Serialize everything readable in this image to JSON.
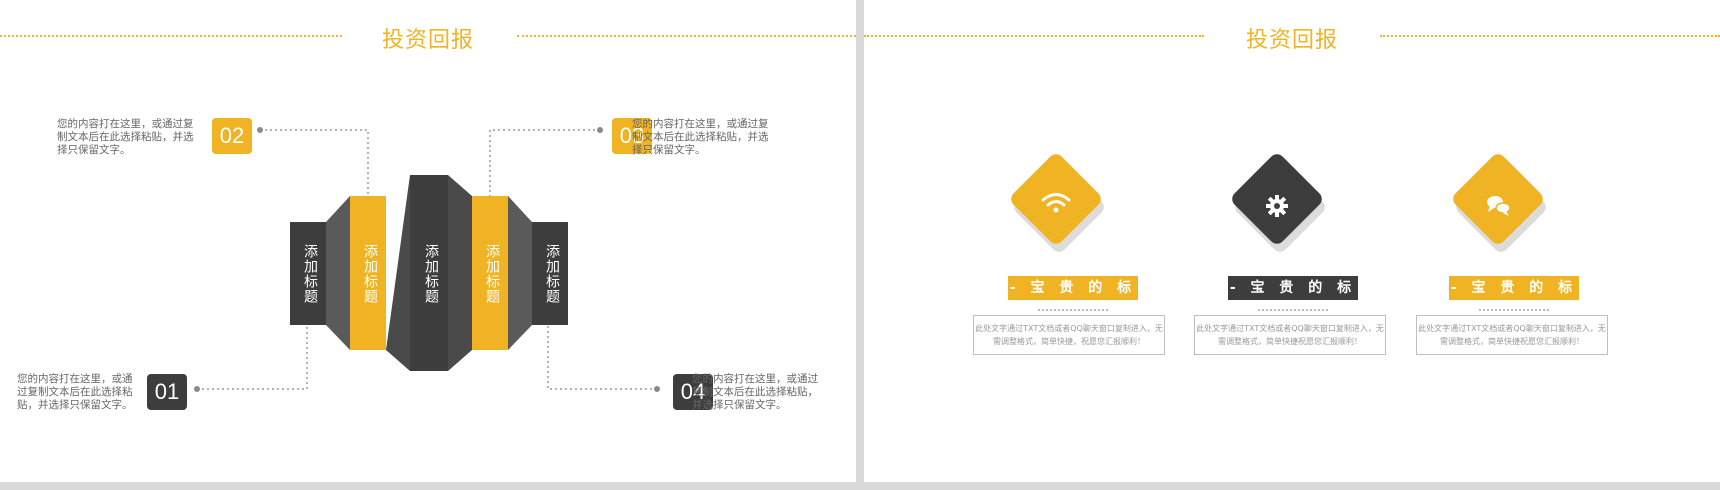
{
  "left_slide": {
    "title": "投资回报",
    "strips": [
      {
        "label": "添加标题",
        "color": "#3d3d3d"
      },
      {
        "label": "添加标题",
        "color": "#f0b323"
      },
      {
        "label": "添加标题",
        "color": "#3d3d3d"
      },
      {
        "label": "添加标题",
        "color": "#f0b323"
      },
      {
        "label": "添加标题",
        "color": "#3d3d3d"
      }
    ],
    "items": [
      {
        "number": "01",
        "text": "您的内容打在这里，或通过复制文本后在此选择粘贴，并选择只保留文字。",
        "color": "#3d3d3d"
      },
      {
        "number": "02",
        "text": "您的内容打在这里，或通过复制文本后在此选择粘贴，并选择只保留文字。",
        "color": "#f0b323"
      },
      {
        "number": "03",
        "text": "您的内容打在这里，或通过复制文本后在此选择粘贴，并选择只保留文字。",
        "color": "#f0b323"
      },
      {
        "number": "04",
        "text": "您的内容打在这里，或通过复制文本后在此选择粘贴，并选择只保留文字。",
        "color": "#3d3d3d"
      }
    ]
  },
  "right_slide": {
    "title": "投资回报",
    "cards": [
      {
        "icon": "wifi-icon",
        "color": "#f0b323",
        "label": "- 宝 贵 的 标 题",
        "text": "此处文字通过TXT文档或者QQ聊天窗口复制进入，无需调整格式，简单快捷，祝愿您汇报顺利！"
      },
      {
        "icon": "gear-icon",
        "color": "#3d3d3d",
        "label": "- 宝 贵 的 标 题",
        "text": "此处文字通过TXT文档或者QQ聊天窗口复制进入，无需调整格式，简单快捷祝愿您汇报顺利！"
      },
      {
        "icon": "chat-icon",
        "color": "#f0b323",
        "label": "- 宝 贵 的 标 题",
        "text": "此处文字通过TXT文档或者QQ聊天窗口复制进入，无需调整格式，简单快捷祝愿您汇报顺利！"
      }
    ]
  },
  "colors": {
    "accent": "#f0b323",
    "dark": "#3d3d3d",
    "background": "#d9d9d9"
  }
}
